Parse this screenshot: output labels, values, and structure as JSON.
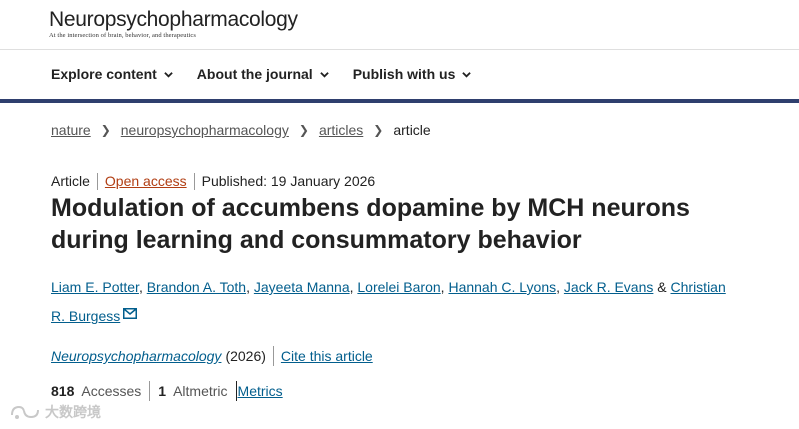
{
  "header": {
    "logo_title": "Neuropsychopharmacology",
    "logo_tagline": "At the intersection of brain, behavior, and therapeutics"
  },
  "nav": {
    "items": [
      {
        "label": "Explore content"
      },
      {
        "label": "About the journal"
      },
      {
        "label": "Publish with us"
      }
    ]
  },
  "breadcrumb": {
    "items": [
      "nature",
      "neuropsychopharmacology",
      "articles"
    ],
    "current": "article"
  },
  "article": {
    "type": "Article",
    "access": "Open access",
    "published": "Published: 19 January 2026",
    "title": "Modulation of accumbens dopamine by MCH neurons during learning and consummatory behavior",
    "authors": [
      "Liam E. Potter",
      "Brandon A. Toth",
      "Jayeeta Manna",
      "Lorelei Baron",
      "Hannah C. Lyons",
      "Jack R. Evans",
      "Christian R. Burgess"
    ],
    "author_separator": ",",
    "author_last_joiner": "&",
    "journal_name": "Neuropsychopharmacology",
    "year": "(2026)",
    "cite_link": "Cite this article"
  },
  "metrics": {
    "accesses_value": "818",
    "accesses_label": "Accesses",
    "altmetric_value": "1",
    "altmetric_label": "Altmetric",
    "metrics_link": "Metrics"
  },
  "watermark": {
    "text": "大数跨境"
  },
  "colors": {
    "link": "#025e8d",
    "open_access": "#b13e13",
    "nav_bar": "#2f3f6e"
  }
}
